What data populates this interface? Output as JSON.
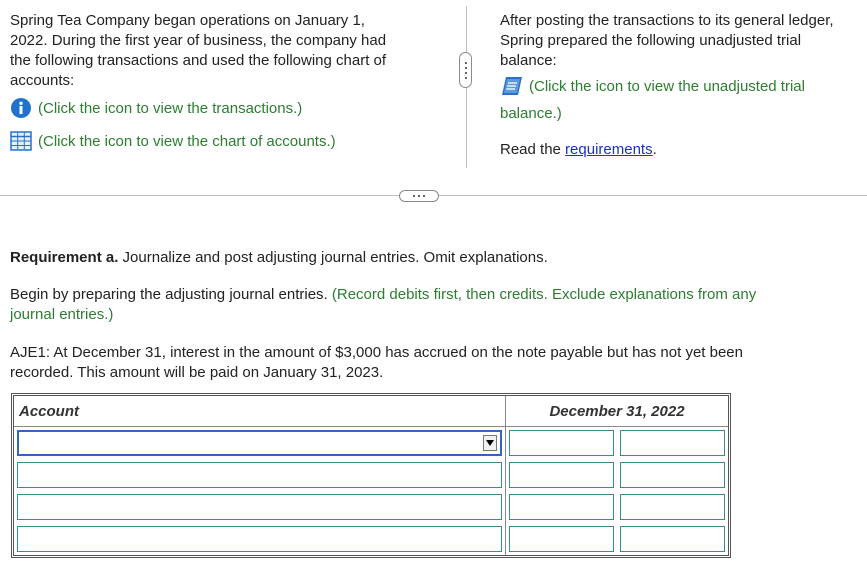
{
  "left_panel": {
    "intro_lines": [
      "Spring Tea Company began operations on January 1,",
      "2022. During the first year of business, the company had",
      "the following transactions and used the following chart of",
      "accounts:"
    ],
    "transactions_link": "(Click the icon to view the transactions.)",
    "chart_link": "(Click the icon to view the chart of accounts.)"
  },
  "right_panel": {
    "intro_lines": [
      "After posting the transactions to its general ledger,",
      "Spring prepared the following unadjusted trial",
      "balance:"
    ],
    "trial_link_line1": "(Click the icon to view the unadjusted trial",
    "trial_link_line2": "balance.)",
    "read_text": "Read the ",
    "requirements_link": "requirements",
    "read_end": "."
  },
  "requirement": {
    "label": "Requirement a.",
    "text": " Journalize and post adjusting journal entries. Omit explanations."
  },
  "instruction": {
    "text": "Begin by preparing the adjusting journal entries. ",
    "green_line1": "(Record debits first, then credits. Exclude explanations from any",
    "green_line2": "journal entries.)"
  },
  "aje": {
    "line1": "AJE1: At December 31, interest in the amount of $3,000 has accrued on the note payable but has not yet been",
    "line2": "recorded. This amount will be paid on January 31, 2023."
  },
  "table": {
    "account_header": "Account",
    "date_header": "December 31, 2022"
  }
}
